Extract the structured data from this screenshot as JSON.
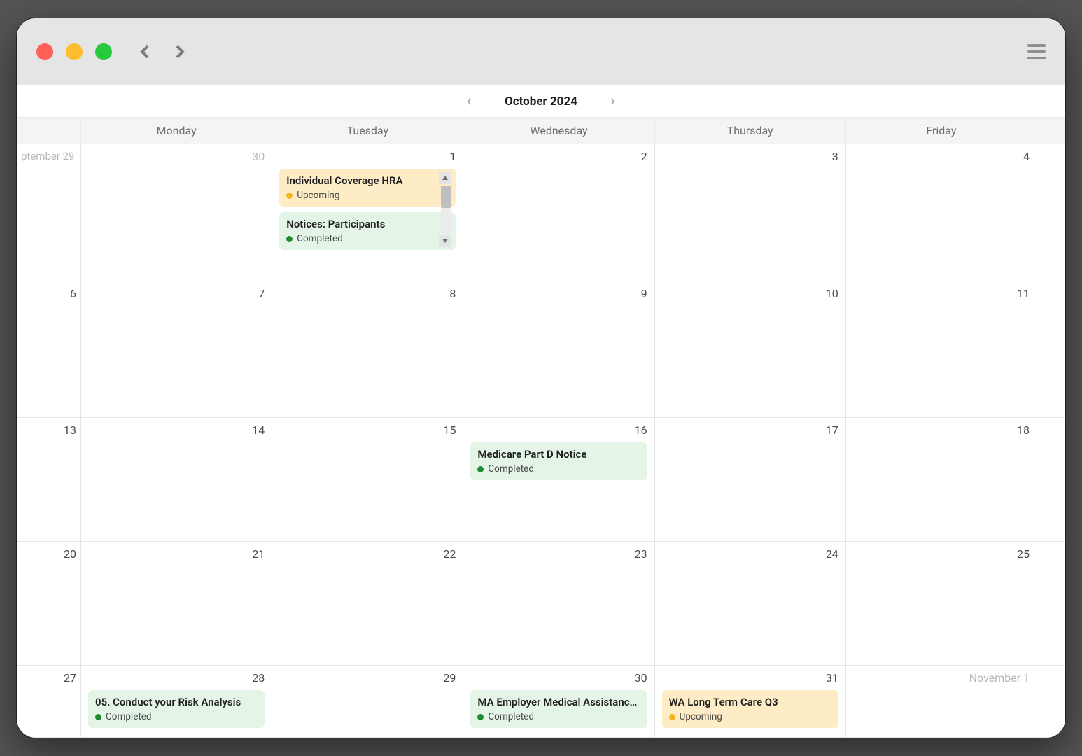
{
  "header": {
    "title": "October 2024"
  },
  "weekdays": [
    "Monday",
    "Tuesday",
    "Wednesday",
    "Thursday",
    "Friday"
  ],
  "stub_left_labels": [
    "ptember 29",
    "",
    "",
    "",
    ""
  ],
  "stub_right_muted": "November 1",
  "dayNumbers": [
    [
      "30",
      "1",
      "2",
      "3",
      "4"
    ],
    [
      "7",
      "8",
      "9",
      "10",
      "11"
    ],
    [
      "14",
      "15",
      "16",
      "17",
      "18"
    ],
    [
      "21",
      "22",
      "23",
      "24",
      "25"
    ],
    [
      "28",
      "29",
      "30",
      "31",
      ""
    ]
  ],
  "leftDayNumbers": [
    "",
    "6",
    "13",
    "20",
    "27"
  ],
  "rowHeights": [
    "1.05fr",
    "1.05fr",
    "0.95fr",
    "0.95fr",
    "0.55fr"
  ],
  "events": {
    "oct1": [
      {
        "title": "Individual Coverage HRA",
        "status": "Upcoming",
        "kind": "upcoming"
      },
      {
        "title": "Notices: Participants",
        "status": "Completed",
        "kind": "completed"
      }
    ],
    "oct15": [
      {
        "title": "Medicare Part D Notice",
        "status": "Completed",
        "kind": "completed"
      }
    ],
    "oct28": [
      {
        "title": "05. Conduct your Risk Analysis",
        "status": "Completed",
        "kind": "completed"
      }
    ],
    "oct30b": [
      {
        "title": "MA Employer Medical Assistance …",
        "status": "Completed",
        "kind": "completed"
      }
    ],
    "oct31": [
      {
        "title": "WA Long Term Care Q3",
        "status": "Upcoming",
        "kind": "upcoming"
      }
    ]
  }
}
